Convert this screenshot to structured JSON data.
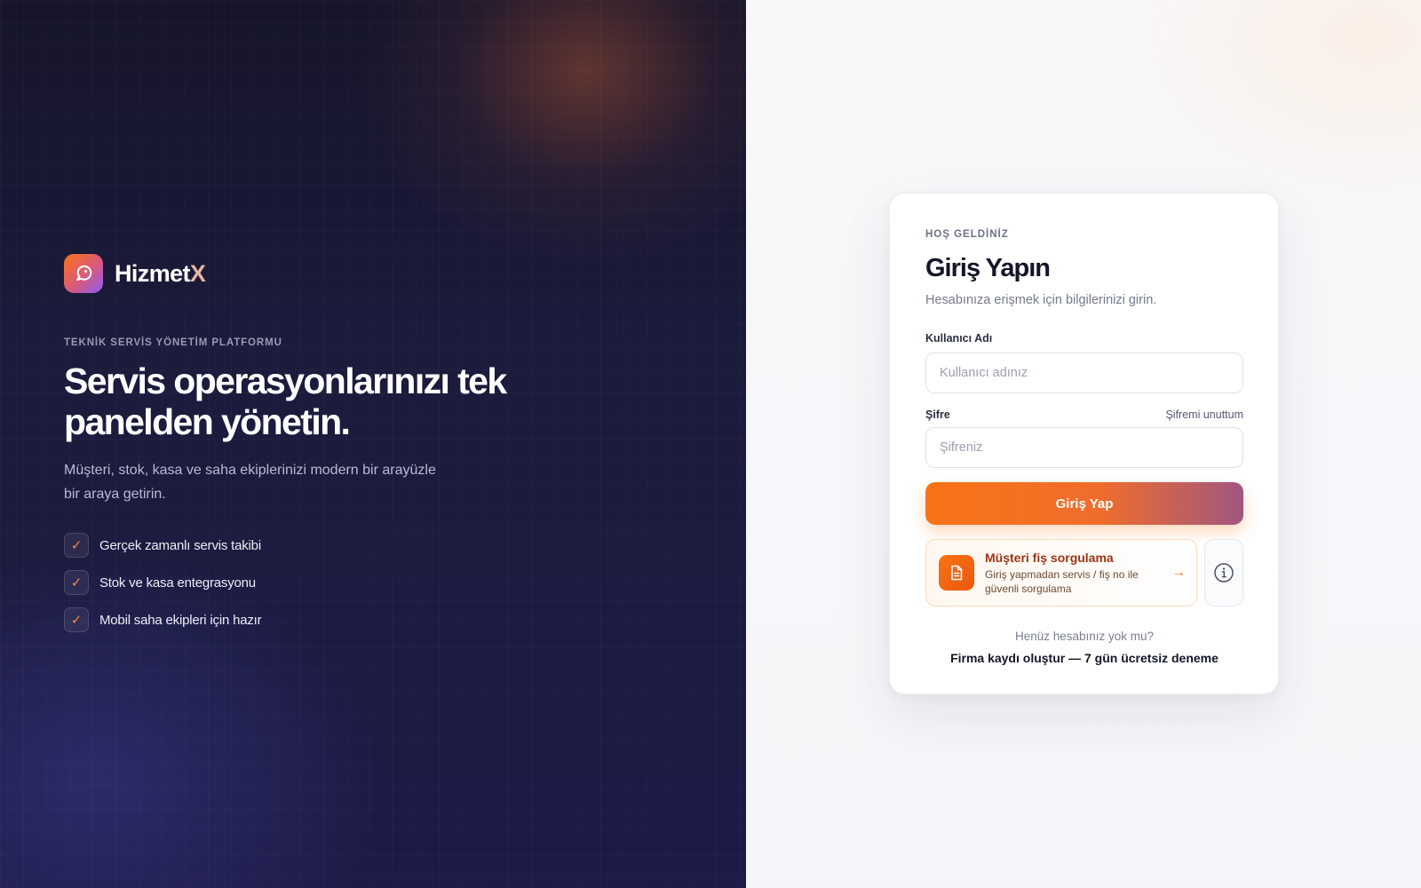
{
  "brand": {
    "name_main": "Hizmet",
    "name_accent": "X"
  },
  "hero": {
    "eyebrow": "TEKNİK SERVİS YÖNETİM PLATFORMU",
    "title": "Servis operasyonlarınızı tek panelden yönetin.",
    "subtitle": "Müşteri, stok, kasa ve saha ekiplerinizi modern bir arayüzle bir araya getirin.",
    "features": [
      {
        "check": "✓",
        "label": "Gerçek zamanlı servis takibi"
      },
      {
        "check": "✓",
        "label": "Stok ve kasa entegrasyonu"
      },
      {
        "check": "✓",
        "label": "Mobil saha ekipleri için hazır"
      }
    ]
  },
  "login": {
    "eyebrow": "HOŞ GELDİNİZ",
    "title": "Giriş Yapın",
    "subtitle": "Hesabınıza erişmek için bilgilerinizi girin.",
    "username": {
      "label": "Kullanıcı Adı",
      "placeholder": "Kullanıcı adınız",
      "value": ""
    },
    "password": {
      "label": "Şifre",
      "placeholder": "Şifreniz",
      "value": "",
      "forgot": "Şifremi unuttum"
    },
    "submit_label": "Giriş Yap",
    "receipt_query": {
      "title": "Müşteri fiş sorgulama",
      "description": "Giriş yapmadan servis / fiş no ile güvenli sorgulama",
      "arrow": "→",
      "icon": "document-icon"
    },
    "info_icon": "info-icon",
    "no_account": "Henüz hesabınız yok mu?",
    "signup": "Firma kaydı oluştur — 7 gün ücretsiz deneme"
  },
  "colors": {
    "accent": "#f97316",
    "accent_dark": "#9a3412",
    "hero_bg": "#1b1b3c",
    "text_dark": "#121627"
  }
}
